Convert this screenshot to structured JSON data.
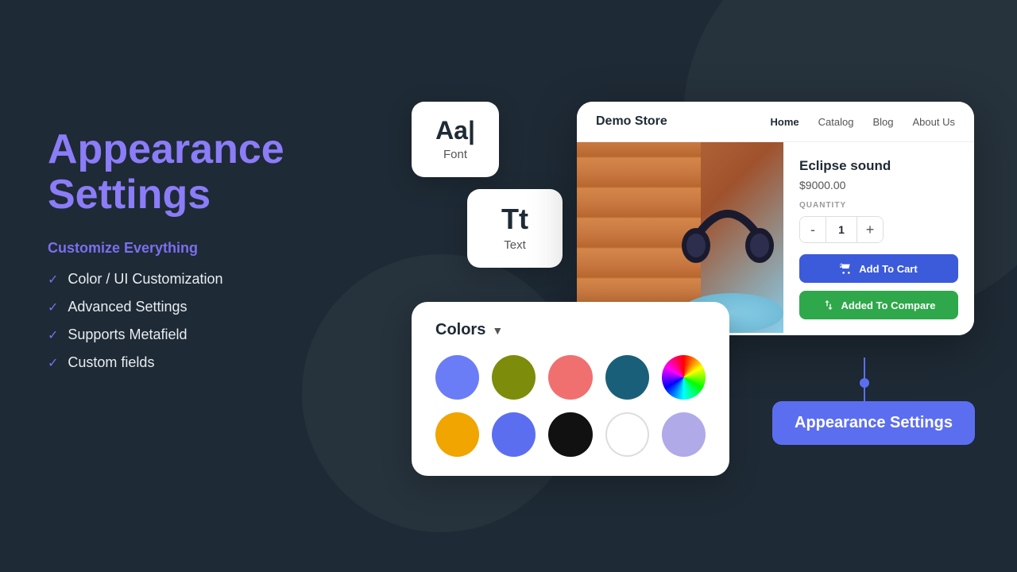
{
  "background": {
    "color": "#1e2a35"
  },
  "left_panel": {
    "title_line1": "Appearance",
    "title_line2": "Settings",
    "customize_label": "Customize Everything",
    "features": [
      "Color / UI Customization",
      "Advanced Settings",
      "Supports Metafield",
      "Custom fields"
    ]
  },
  "font_card": {
    "display": "Aa|",
    "label": "Font"
  },
  "text_card": {
    "icon": "Tt",
    "label": "Text"
  },
  "colors_panel": {
    "header": "Colors",
    "swatches_row1": [
      {
        "color": "#6b7cf7",
        "name": "blue"
      },
      {
        "color": "#7d8c0a",
        "name": "olive"
      },
      {
        "color": "#f07070",
        "name": "salmon"
      },
      {
        "color": "#1a5f7a",
        "name": "teal"
      },
      {
        "color": "conic-gradient",
        "name": "rainbow"
      }
    ],
    "swatches_row2": [
      {
        "color": "#f0a500",
        "name": "orange"
      },
      {
        "color": "#5c6ef0",
        "name": "indigo"
      },
      {
        "color": "#111111",
        "name": "black"
      },
      {
        "color": "#ffffff",
        "name": "white"
      },
      {
        "color": "#b0aae8",
        "name": "lavender"
      }
    ]
  },
  "demo_store": {
    "store_name": "Demo Store",
    "nav_links": [
      {
        "label": "Home",
        "active": true
      },
      {
        "label": "Catalog",
        "active": false
      },
      {
        "label": "Blog",
        "active": false
      },
      {
        "label": "About Us",
        "active": false
      }
    ],
    "product": {
      "name": "Eclipse sound",
      "price": "$9000.00",
      "quantity_label": "QUANTITY",
      "quantity": "1",
      "add_to_cart": "Add To Cart",
      "added_to_compare": "Added To Compare"
    }
  },
  "appearance_button": {
    "label": "Appearance Settings"
  }
}
